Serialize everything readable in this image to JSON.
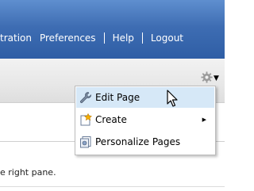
{
  "header": {
    "nav": [
      {
        "label": "tration"
      },
      {
        "label": "Preferences"
      },
      {
        "label": "Help"
      },
      {
        "label": "Logout"
      }
    ]
  },
  "toolbar": {
    "settings_icon": "gear-icon",
    "dropdown_icon": "caret-down-icon"
  },
  "menu": {
    "items": [
      {
        "label": "Edit Page",
        "icon": "wrench-icon",
        "highlighted": true
      },
      {
        "label": "Create",
        "icon": "new-item-icon",
        "has_submenu": true
      },
      {
        "label": "Personalize Pages",
        "icon": "personalize-icon"
      }
    ]
  },
  "content": {
    "text": "e right pane."
  },
  "colors": {
    "header_blue": "#3e6db3",
    "menu_highlight": "#d6e8f7"
  }
}
